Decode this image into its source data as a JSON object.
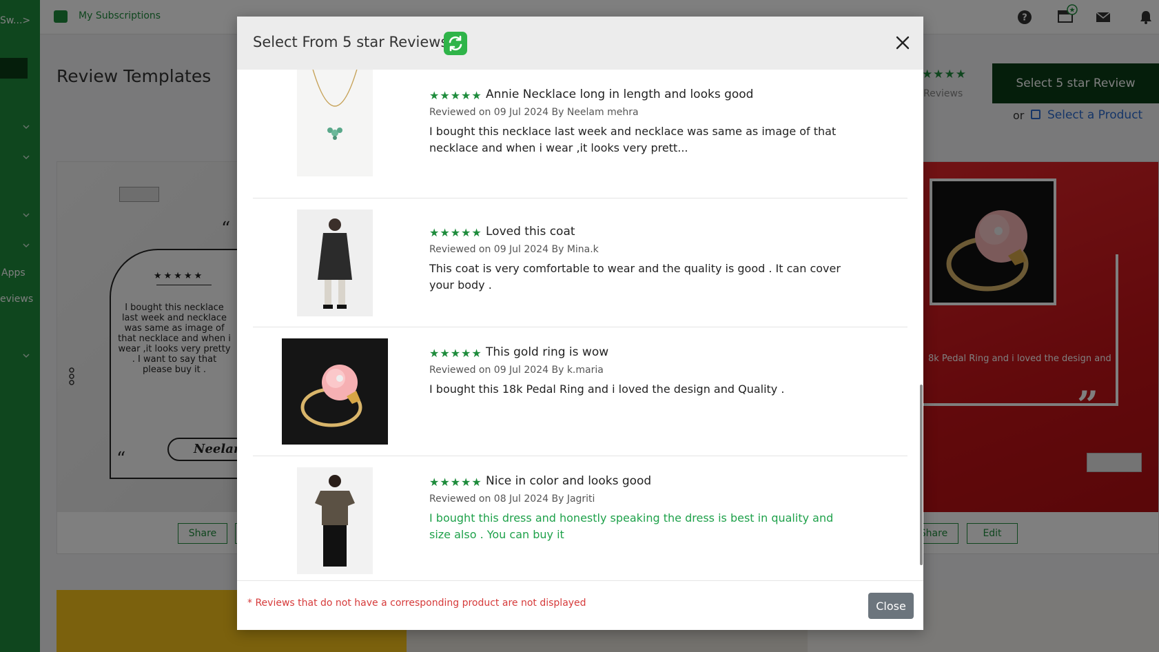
{
  "sidebar": {
    "brand": "Sw...>",
    "labels": [
      "Apps",
      "eviews"
    ]
  },
  "topbar": {
    "subscriptions_label": "My Subscriptions",
    "icons": [
      "help-icon",
      "gift-icon",
      "mail-icon",
      "bell-icon"
    ]
  },
  "page": {
    "title": "Review Templates",
    "stars": "★★★★",
    "reviews_label": "Reviews",
    "select_5_star_button": "Select 5 star Review",
    "or_label": "or",
    "select_product_link": "Select a Product"
  },
  "left_card": {
    "stars": "★★★★★",
    "review_text": "I bought this necklace last week and necklace was same as image of that necklace and when i wear ,it looks very pretty . I want to say that please buy it .",
    "name": "Neelam",
    "share_label": "Share"
  },
  "right_card": {
    "review_text": "8k Pedal Ring and i loved the design and",
    "share_label": "Share",
    "edit_label": "Edit"
  },
  "modal": {
    "title": "Select From 5 star Reviews",
    "footer_note": "* Reviews that do not have a corresponding product are not displayed",
    "close_label": "Close",
    "reviews": [
      {
        "stars": "★★★★★",
        "title": "Annie Necklace long in length and looks good",
        "meta": "Reviewed on 09 Jul 2024 By Neelam mehra",
        "text": "I bought this necklace last week and necklace was same as image of that necklace and when i wear ,it looks very prett...",
        "thumb": "necklace"
      },
      {
        "stars": "★★★★★",
        "title": "Loved this coat",
        "meta": "Reviewed on 09 Jul 2024 By Mina.k",
        "text": "This coat is very comfortable to wear and the quality is good . It can cover your body .",
        "thumb": "coat"
      },
      {
        "stars": "★★★★★",
        "title": "This gold ring is wow",
        "meta": "Reviewed on 09 Jul 2024 By k.maria",
        "text": "I bought this 18k Pedal Ring and i loved the design and Quality .",
        "thumb": "ring"
      },
      {
        "stars": "★★★★★",
        "title": "Nice in color and looks good",
        "meta": "Reviewed on 08 Jul 2024 By Jagriti",
        "text": "I bought this dress and honestly speaking the dress is best in quality and size also . You can buy it",
        "thumb": "tshirt",
        "text_color": "#1ea14a"
      }
    ]
  },
  "colors": {
    "brand_green": "#1e8c3c",
    "dark_green": "#0b3d17",
    "link_blue": "#2a6bd1",
    "warning_red": "#d63a3a",
    "close_gray": "#6c757d"
  }
}
